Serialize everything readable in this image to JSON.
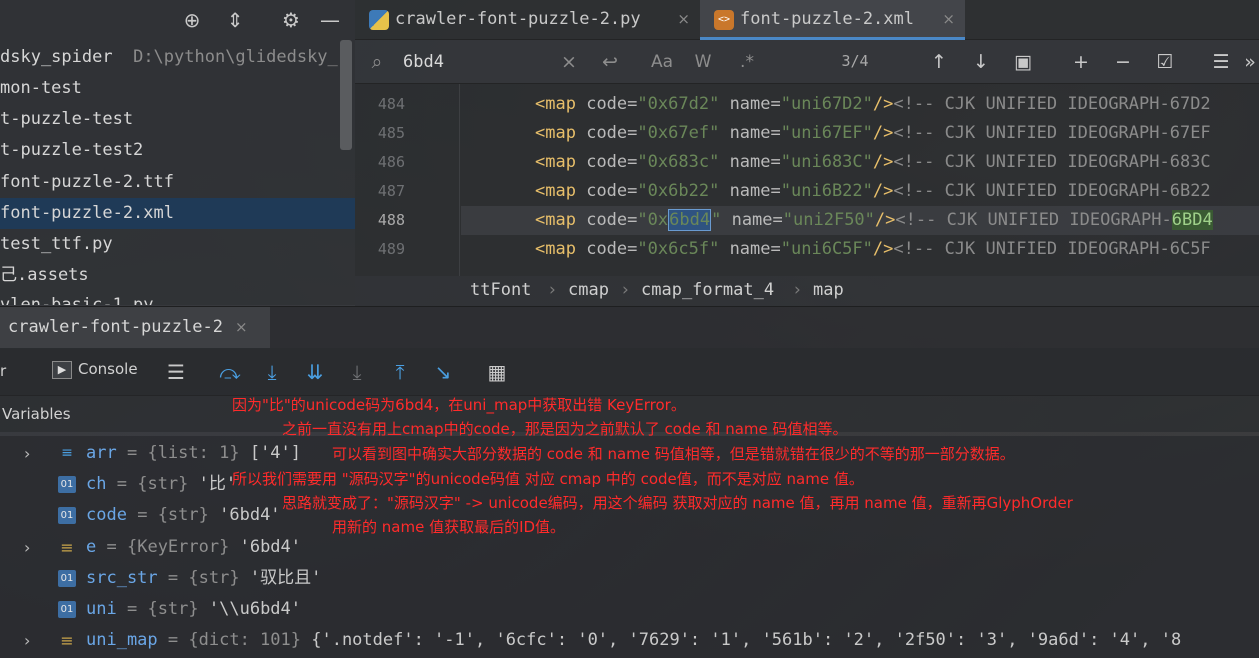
{
  "project": {
    "items": [
      {
        "label": "dsky_spider",
        "path": "D:\\python\\glidedsky_"
      },
      {
        "label": "mon-test"
      },
      {
        "label": "t-puzzle-test"
      },
      {
        "label": "t-puzzle-test2"
      },
      {
        "label": "font-puzzle-2.ttf"
      },
      {
        "label": "font-puzzle-2.xml"
      },
      {
        "label": "test_ttf.py"
      },
      {
        "label": "己.assets"
      },
      {
        "label": "vlen-basic-1.py"
      }
    ]
  },
  "tabs": [
    {
      "label": "crawler-font-puzzle-2.py",
      "close": "×"
    },
    {
      "label": "font-puzzle-2.xml",
      "close": "×"
    }
  ],
  "search": {
    "value": "6bd4",
    "match": "3/4",
    "case_label": "Aa",
    "word_label": "W",
    "regex_label": ".*"
  },
  "code": {
    "lines": [
      {
        "num": "484",
        "code": "0x67d2",
        "name": "uni67D2",
        "comment": "<!-- CJK UNIFIED IDEOGRAPH-67D2"
      },
      {
        "num": "485",
        "code": "0x67ef",
        "name": "uni67EF",
        "comment": "<!-- CJK UNIFIED IDEOGRAPH-67EF"
      },
      {
        "num": "486",
        "code": "0x683c",
        "name": "uni683C",
        "comment": "<!-- CJK UNIFIED IDEOGRAPH-683C"
      },
      {
        "num": "487",
        "code": "0x6b22",
        "name": "uni6B22",
        "comment": "<!-- CJK UNIFIED IDEOGRAPH-6B22"
      },
      {
        "num": "488",
        "code_prefix": "0x",
        "code_hl": "6bd4",
        "name": "uni2F50",
        "comment_prefix": "<!-- CJK UNIFIED IDEOGRAPH-",
        "comment_hl": "6BD4"
      },
      {
        "num": "489",
        "code": "0x6c5f",
        "name": "uni6C5F",
        "comment": "<!-- CJK UNIFIED IDEOGRAPH-6C5F"
      }
    ],
    "tag_open": "<map",
    "code_attr": "code=",
    "name_attr": "name=",
    "tag_close": "/>"
  },
  "breadcrumb": [
    "ttFont",
    "cmap",
    "cmap_format_4",
    "map"
  ],
  "debug": {
    "run_tab": "crawler-font-puzzle-2",
    "frames_label": "r",
    "console_label": "Console",
    "variables_label": "Variables"
  },
  "variables": [
    {
      "name": "arr",
      "type": "{list: 1}",
      "value": "['4']",
      "kind": "list",
      "expandable": true
    },
    {
      "name": "ch",
      "type": "{str}",
      "value": "'比'",
      "kind": "str",
      "expandable": false
    },
    {
      "name": "code",
      "type": "{str}",
      "value": "'6bd4'",
      "kind": "str",
      "expandable": false
    },
    {
      "name": "e",
      "type": "{KeyError}",
      "value": "'6bd4'",
      "kind": "obj",
      "expandable": true
    },
    {
      "name": "src_str",
      "type": "{str}",
      "value": "'驭比且'",
      "kind": "str",
      "expandable": false
    },
    {
      "name": "uni",
      "type": "{str}",
      "value": "'\\\\u6bd4'",
      "kind": "str",
      "expandable": false
    },
    {
      "name": "uni_map",
      "type": "{dict: 101}",
      "value": "{'.notdef': '-1', '6cfc': '0', '7629': '1', '561b': '2', '2f50': '3', '9a6d': '4', '8",
      "kind": "obj",
      "expandable": true
    }
  ],
  "annotations": [
    "因为\"比\"的unicode码为6bd4，在uni_map中获取出错 KeyError。",
    "之前一直没有用上cmap中的code，那是因为之前默认了 code 和 name 码值相等。",
    "可以看到图中确实大部分数据的 code 和 name 码值相等，但是错就错在很少的不等的那一部分数据。",
    "所以我们需要用 \"源码汉字\"的unicode码值 对应 cmap 中的 code值，而不是对应 name 值。",
    "思路就变成了：\"源码汉字\" -> unicode编码，用这个编码 获取对应的 name 值，再用 name 值，重新再GlyphOrder",
    "用新的 name 值获取最后的ID值。"
  ],
  "colors": {
    "accent": "#4a88c7",
    "annotation": "#ff2b2b",
    "selected": "#1f3a57"
  }
}
